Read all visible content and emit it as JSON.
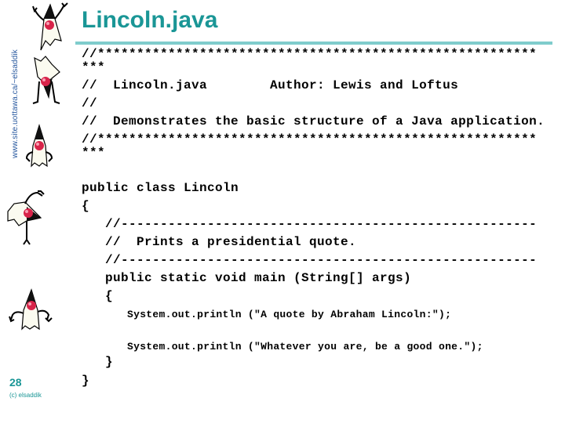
{
  "sidebar": {
    "url_label": "www.site.uottawa.ca/~elsaddik"
  },
  "slide": {
    "title": "Lincoln.java",
    "page_number": "28",
    "copyright": "(c) elsaddik",
    "accent_color": "#1a9696",
    "rule_color": "#7fcccc"
  },
  "code": {
    "lines": [
      "//********************************************************",
      "***",
      "//  Lincoln.java        Author: Lewis and Loftus",
      "//",
      "//  Demonstrates the basic structure of a Java application.",
      "//********************************************************",
      "***",
      "public class Lincoln",
      "{",
      "   //-----------------------------------------------------",
      "   //  Prints a presidential quote.",
      "   //-----------------------------------------------------",
      "   public static void main (String[] args)",
      "   {",
      "System.out.println (\"A quote by Abraham Lincoln:\");",
      "System.out.println (\"Whatever you are, be a good one.\");",
      "   }",
      "}"
    ]
  },
  "icons": {
    "mascots": [
      "duke-arms-up-icon",
      "duke-upside-down-icon",
      "duke-hands-on-hips-icon",
      "duke-tumbling-icon",
      "duke-waving-icon"
    ]
  }
}
